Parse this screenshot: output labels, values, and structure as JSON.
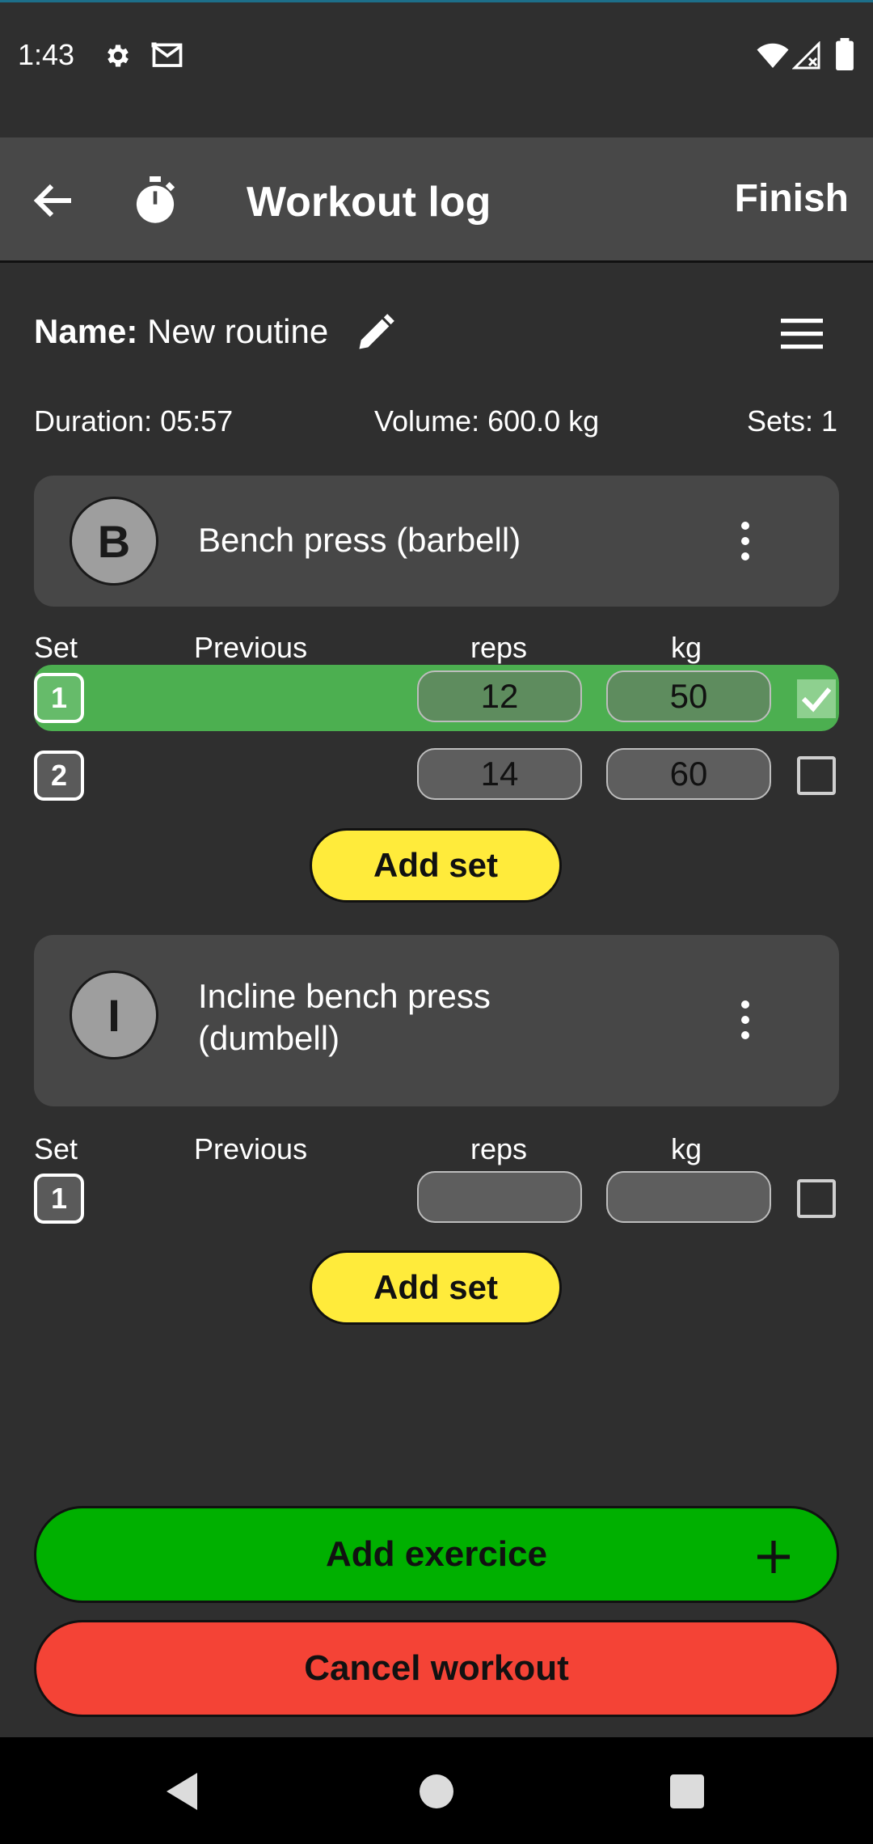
{
  "status_bar": {
    "time": "1:43",
    "icons": [
      "gear-icon",
      "mail-icon",
      "wifi-icon",
      "signal-icon",
      "battery-icon"
    ]
  },
  "app_bar": {
    "title": "Workout log",
    "finish": "Finish",
    "icons": [
      "back-arrow-icon",
      "stopwatch-icon"
    ]
  },
  "routine": {
    "name_label": "Name:",
    "name_value": "New routine"
  },
  "stats": {
    "duration": "Duration: 05:57",
    "volume": "Volume: 600.0 kg",
    "sets": "Sets: 1"
  },
  "exercises": [
    {
      "avatar": "B",
      "title": "Bench press (barbell)",
      "headers": {
        "set": "Set",
        "previous": "Previous",
        "reps": "reps",
        "kg": "kg"
      },
      "sets": [
        {
          "num": "1",
          "reps": "12",
          "kg": "50",
          "done": true
        },
        {
          "num": "2",
          "reps": "14",
          "kg": "60",
          "done": false
        }
      ],
      "add_set": "Add set"
    },
    {
      "avatar": "I",
      "title_line1": "Incline bench press",
      "title_line2": "(dumbell)",
      "headers": {
        "set": "Set",
        "previous": "Previous",
        "reps": "reps",
        "kg": "kg"
      },
      "sets": [
        {
          "num": "1",
          "reps": "",
          "kg": "",
          "done": false
        }
      ],
      "add_set": "Add set"
    }
  ],
  "buttons": {
    "add_exercise": "Add exercice",
    "cancel_workout": "Cancel workout"
  },
  "colors": {
    "done_row": "#4caf50",
    "add_set": "#ffeb3b",
    "add_exercise": "#00b000",
    "cancel": "#f44336"
  }
}
